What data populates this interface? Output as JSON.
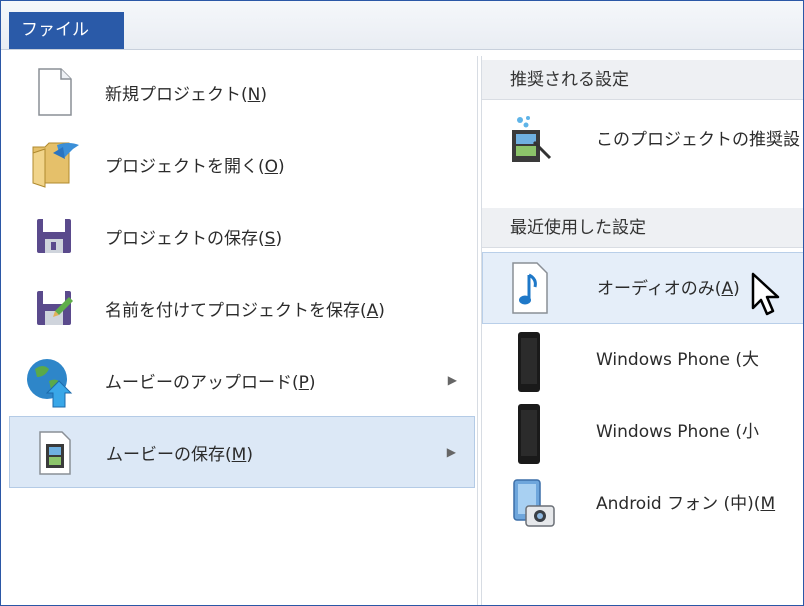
{
  "file_tab": {
    "label": "ファイル"
  },
  "left_menu": [
    {
      "name": "new-project",
      "label": "新規プロジェクト(",
      "key": "N",
      "suffix": ")",
      "icon": "blank-document-icon",
      "has_submenu": false
    },
    {
      "name": "open-project",
      "label": "プロジェクトを開く(",
      "key": "O",
      "suffix": ")",
      "icon": "open-folder-icon",
      "has_submenu": false
    },
    {
      "name": "save-project",
      "label": "プロジェクトの保存(",
      "key": "S",
      "suffix": ")",
      "icon": "floppy-disk-icon",
      "has_submenu": false
    },
    {
      "name": "save-project-as",
      "label": "名前を付けてプロジェクトを保存(",
      "key": "A",
      "suffix": ")",
      "icon": "save-as-icon",
      "has_submenu": false
    },
    {
      "name": "upload-movie",
      "label": "ムービーのアップロード(",
      "key": "P",
      "suffix": ")",
      "icon": "globe-upload-icon",
      "has_submenu": true
    },
    {
      "name": "save-movie",
      "label": "ムービーの保存(",
      "key": "M",
      "suffix": ")",
      "icon": "film-document-icon",
      "has_submenu": true,
      "selected": true
    }
  ],
  "right_menu": {
    "recommended_header": "推奨される設定",
    "recommended_item": {
      "label": "このプロジェクトの推奨設",
      "icon": "recommended-settings-icon"
    },
    "recent_header": "最近使用した設定",
    "recent_items": [
      {
        "name": "audio-only",
        "label": "オーディオのみ(",
        "key": "A",
        "suffix": ")",
        "icon": "music-note-icon",
        "hover": true
      },
      {
        "name": "windows-phone-large",
        "label": "Windows Phone (大",
        "key": "",
        "suffix": "",
        "icon": "phone-icon"
      },
      {
        "name": "windows-phone-small",
        "label": "Windows Phone (小",
        "key": "",
        "suffix": "",
        "icon": "phone-icon"
      },
      {
        "name": "android-phone-medium",
        "label": "Android フォン (中)(",
        "key": "M",
        "suffix": "",
        "icon": "android-device-icon"
      }
    ]
  }
}
